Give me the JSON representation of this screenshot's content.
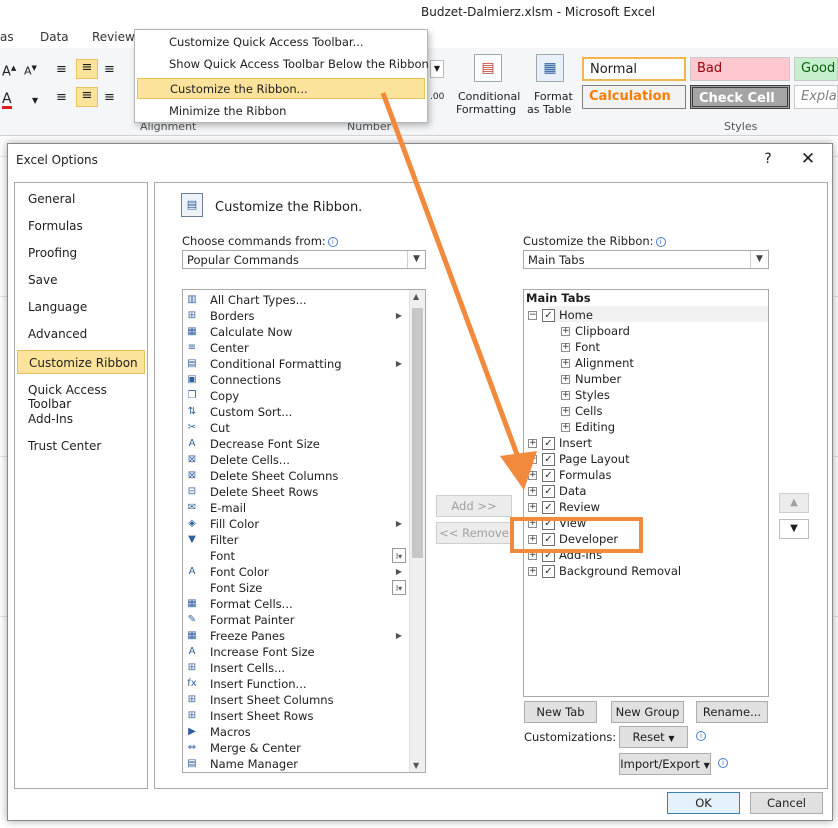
{
  "window": {
    "title": "Budzet-Dalmierz.xlsm  -  Microsoft Excel"
  },
  "ribbon_tabs": [
    "as",
    "Data",
    "Review"
  ],
  "ribbon": {
    "group_alignment": "Alignment",
    "group_number": "Number",
    "group_styles": "Styles",
    "cond_format_line1": "Conditional",
    "cond_format_line2": "Formatting",
    "format_table_line1": "Format",
    "format_table_line2": "as Table",
    "styles": {
      "normal": "Normal",
      "bad": "Bad",
      "good": "Good",
      "calculation": "Calculation",
      "check_cell": "Check Cell",
      "explanatory": "Explar"
    }
  },
  "qat_menu": {
    "items": [
      "Customize Quick Access Toolbar...",
      "Show Quick Access Toolbar Below the Ribbon",
      "Customize the Ribbon...",
      "Minimize the Ribbon"
    ],
    "highlighted_index": 2
  },
  "dialog": {
    "title": "Excel Options",
    "help": "?",
    "close": "✕",
    "nav": [
      "General",
      "Formulas",
      "Proofing",
      "Save",
      "Language",
      "Advanced",
      "Customize Ribbon",
      "Quick Access Toolbar",
      "Add-Ins",
      "Trust Center"
    ],
    "nav_selected": "Customize Ribbon",
    "heading": "Customize the Ribbon.",
    "choose_label": "Choose commands from:",
    "choose_value": "Popular Commands",
    "customize_label": "Customize the Ribbon:",
    "customize_value": "Main Tabs",
    "commands": [
      {
        "label": "All Chart Types...",
        "icon": "chart-icon",
        "glyph": "▥",
        "extra": ""
      },
      {
        "label": "Borders",
        "icon": "borders-icon",
        "glyph": "⊞",
        "extra": "▶"
      },
      {
        "label": "Calculate Now",
        "icon": "calculator-icon",
        "glyph": "▦",
        "extra": ""
      },
      {
        "label": "Center",
        "icon": "center-align-icon",
        "glyph": "≡",
        "extra": ""
      },
      {
        "label": "Conditional Formatting",
        "icon": "conditional-formatting-icon",
        "glyph": "▤",
        "extra": "▶"
      },
      {
        "label": "Connections",
        "icon": "connections-icon",
        "glyph": "▣",
        "extra": ""
      },
      {
        "label": "Copy",
        "icon": "copy-icon",
        "glyph": "❐",
        "extra": ""
      },
      {
        "label": "Custom Sort...",
        "icon": "sort-icon",
        "glyph": "⇅",
        "extra": ""
      },
      {
        "label": "Cut",
        "icon": "scissors-icon",
        "glyph": "✂",
        "extra": ""
      },
      {
        "label": "Decrease Font Size",
        "icon": "decrease-font-icon",
        "glyph": "A",
        "extra": ""
      },
      {
        "label": "Delete Cells...",
        "icon": "delete-cells-icon",
        "glyph": "⊠",
        "extra": ""
      },
      {
        "label": "Delete Sheet Columns",
        "icon": "delete-columns-icon",
        "glyph": "⊠",
        "extra": ""
      },
      {
        "label": "Delete Sheet Rows",
        "icon": "delete-rows-icon",
        "glyph": "⊟",
        "extra": ""
      },
      {
        "label": "E-mail",
        "icon": "email-icon",
        "glyph": "✉",
        "extra": ""
      },
      {
        "label": "Fill Color",
        "icon": "fill-color-icon",
        "glyph": "◈",
        "extra": "▶"
      },
      {
        "label": "Filter",
        "icon": "filter-icon",
        "glyph": "▼",
        "extra": ""
      },
      {
        "label": "Font",
        "icon": "",
        "glyph": "",
        "extra": "I▾"
      },
      {
        "label": "Font Color",
        "icon": "font-color-icon",
        "glyph": "A",
        "extra": "▶"
      },
      {
        "label": "Font Size",
        "icon": "",
        "glyph": "",
        "extra": "I▾"
      },
      {
        "label": "Format Cells...",
        "icon": "format-cells-icon",
        "glyph": "▦",
        "extra": ""
      },
      {
        "label": "Format Painter",
        "icon": "format-painter-icon",
        "glyph": "✎",
        "extra": ""
      },
      {
        "label": "Freeze Panes",
        "icon": "freeze-panes-icon",
        "glyph": "▦",
        "extra": "▶"
      },
      {
        "label": "Increase Font Size",
        "icon": "increase-font-icon",
        "glyph": "A",
        "extra": ""
      },
      {
        "label": "Insert Cells...",
        "icon": "insert-cells-icon",
        "glyph": "⊞",
        "extra": ""
      },
      {
        "label": "Insert Function...",
        "icon": "function-icon",
        "glyph": "fx",
        "extra": ""
      },
      {
        "label": "Insert Sheet Columns",
        "icon": "insert-columns-icon",
        "glyph": "⊞",
        "extra": ""
      },
      {
        "label": "Insert Sheet Rows",
        "icon": "insert-rows-icon",
        "glyph": "⊞",
        "extra": ""
      },
      {
        "label": "Macros",
        "icon": "macros-icon",
        "glyph": "▶",
        "extra": ""
      },
      {
        "label": "Merge & Center",
        "icon": "merge-center-icon",
        "glyph": "⇔",
        "extra": ""
      },
      {
        "label": "Name Manager",
        "icon": "name-manager-icon",
        "glyph": "▤",
        "extra": ""
      }
    ],
    "tree_header": "Main Tabs",
    "tree": [
      {
        "label": "Home",
        "level": 0,
        "expander": "−",
        "checked": true
      },
      {
        "label": "Clipboard",
        "level": 1,
        "expander": "+",
        "checked": null
      },
      {
        "label": "Font",
        "level": 1,
        "expander": "+",
        "checked": null
      },
      {
        "label": "Alignment",
        "level": 1,
        "expander": "+",
        "checked": null
      },
      {
        "label": "Number",
        "level": 1,
        "expander": "+",
        "checked": null
      },
      {
        "label": "Styles",
        "level": 1,
        "expander": "+",
        "checked": null
      },
      {
        "label": "Cells",
        "level": 1,
        "expander": "+",
        "checked": null
      },
      {
        "label": "Editing",
        "level": 1,
        "expander": "+",
        "checked": null
      },
      {
        "label": "Insert",
        "level": 0,
        "expander": "+",
        "checked": true
      },
      {
        "label": "Page Layout",
        "level": 0,
        "expander": "+",
        "checked": true
      },
      {
        "label": "Formulas",
        "level": 0,
        "expander": "+",
        "checked": true
      },
      {
        "label": "Data",
        "level": 0,
        "expander": "+",
        "checked": true
      },
      {
        "label": "Review",
        "level": 0,
        "expander": "+",
        "checked": true
      },
      {
        "label": "View",
        "level": 0,
        "expander": "+",
        "checked": true
      },
      {
        "label": "Developer",
        "level": 0,
        "expander": "+",
        "checked": true
      },
      {
        "label": "Add-Ins",
        "level": 0,
        "expander": "+",
        "checked": true
      },
      {
        "label": "Background Removal",
        "level": 0,
        "expander": "+",
        "checked": true
      }
    ],
    "buttons": {
      "add": "Add >>",
      "remove": "<< Remove",
      "move_up": "▲",
      "move_down": "▼",
      "new_tab": "New Tab",
      "new_group": "New Group",
      "rename": "Rename...",
      "customizations_label": "Customizations:",
      "reset": "Reset",
      "import_export": "Import/Export",
      "ok": "OK",
      "cancel": "Cancel"
    }
  },
  "colors": {
    "highlight": "#fbe39c",
    "annotation": "#f28a3e",
    "accent_blue": "#4a7ec7"
  }
}
